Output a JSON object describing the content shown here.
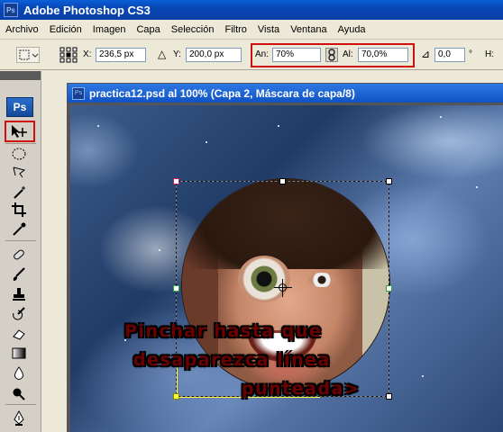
{
  "app": {
    "title": "Adobe Photoshop CS3",
    "logo_text": "Ps"
  },
  "menu": [
    "Archivo",
    "Edición",
    "Imagen",
    "Capa",
    "Selección",
    "Filtro",
    "Vista",
    "Ventana",
    "Ayuda"
  ],
  "options": {
    "x_label": "X:",
    "x_value": "236,5 px",
    "y_label": "Y:",
    "y_value": "200,0 px",
    "width_label": "An:",
    "width_value": "70%",
    "height_label": "Al:",
    "height_value": "70,0%",
    "rotate_value": "0,0",
    "angle_unit": "°",
    "hskew_label": "H:"
  },
  "document": {
    "title": "practica12.psd al 100% (Capa 2, Máscara de capa/8)",
    "icon_text": "Ps"
  },
  "annotation": {
    "line1": "Pinchar hasta que",
    "line2": "desaparezca línea",
    "line3": "punteada>"
  },
  "colors": {
    "highlight": "#d01010",
    "annotation_text": "#6b0000",
    "selection_yellow": "#ffff40"
  },
  "icons": [
    "move-tool-icon",
    "marquee-tool-icon",
    "lasso-tool-icon",
    "magic-wand-icon",
    "crop-tool-icon",
    "eyedropper-icon",
    "healing-brush-icon",
    "brush-tool-icon",
    "clone-stamp-icon",
    "history-brush-icon",
    "eraser-icon",
    "gradient-tool-icon",
    "blur-tool-icon",
    "dodge-tool-icon",
    "pen-tool-icon",
    "link-chain-icon",
    "rotate-angle-icon"
  ]
}
